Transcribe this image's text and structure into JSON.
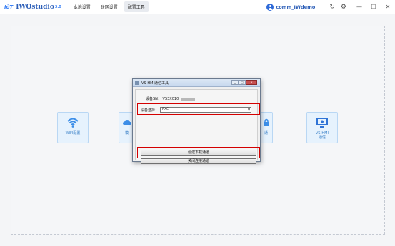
{
  "app": {
    "logo_mark": "IōT",
    "name": "IWOstudio",
    "version": "3.0"
  },
  "nav": {
    "tabs": [
      {
        "label": "本地设置"
      },
      {
        "label": "联网设置"
      },
      {
        "label": "配置工具"
      }
    ],
    "active_tab": "配置工具"
  },
  "user": {
    "name": "comm_IWdemo"
  },
  "tool_cards": [
    {
      "label": "WIFI配置",
      "icon": "wifi-icon"
    },
    {
      "label": "模",
      "icon": "cloud-icon"
    },
    {
      "label": "通",
      "icon": "lock-icon"
    },
    {
      "label": "VS-HMI\n通信",
      "icon": "monitor-icon"
    }
  ],
  "dialog": {
    "title": "VS-HMI通信工具",
    "sn_label": "设备SN：",
    "sn_value": "VS3X010",
    "select_label": "设备选择：",
    "select_value": "RXC",
    "create_button": "创建下载通道",
    "close_button": "关闭连接通道"
  },
  "colors": {
    "accent": "#2f6bd8",
    "highlight": "#d40000",
    "card_bg": "#e6f2fd"
  }
}
